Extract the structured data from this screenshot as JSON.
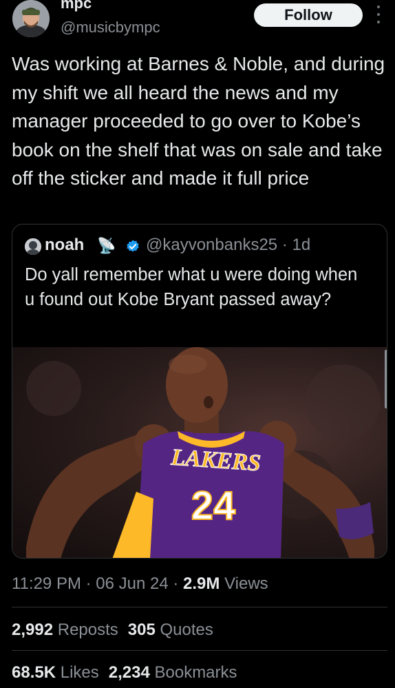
{
  "author": {
    "name": "mpc",
    "handle": "@musicbympc",
    "follow_label": "Follow"
  },
  "tweet": {
    "text": "Was working at Barnes & Noble, and during my shift we all heard the news and my manager proceeded to go over to Kobe’s book on the shelf that was on sale and take off the sticker and made it full price"
  },
  "quote": {
    "name": "noah",
    "name_emoji": "📡",
    "handle_time": "@kayvonbanks25 · 1d",
    "text": "Do yall remember what u were doing when u found out Kobe Bryant passed away?",
    "image": {
      "jersey_text": "LAKERS",
      "jersey_number": "24"
    }
  },
  "meta": {
    "time": "11:29 PM",
    "sep1": " · ",
    "date": "06 Jun 24",
    "sep2": " · ",
    "views_count": "2.9M",
    "views_label": "Views"
  },
  "stats": {
    "reposts_count": "2,992",
    "reposts_label": "Reposts",
    "quotes_count": "305",
    "quotes_label": "Quotes",
    "likes_count": "68.5K",
    "likes_label": "Likes",
    "bookmarks_count": "2,234",
    "bookmarks_label": "Bookmarks"
  },
  "colors": {
    "background": "#000000",
    "text": "#e7e9ea",
    "secondary": "#8b9096",
    "verified": "#1d9bf0",
    "lakers_purple": "#552583",
    "lakers_gold": "#fdb927"
  }
}
